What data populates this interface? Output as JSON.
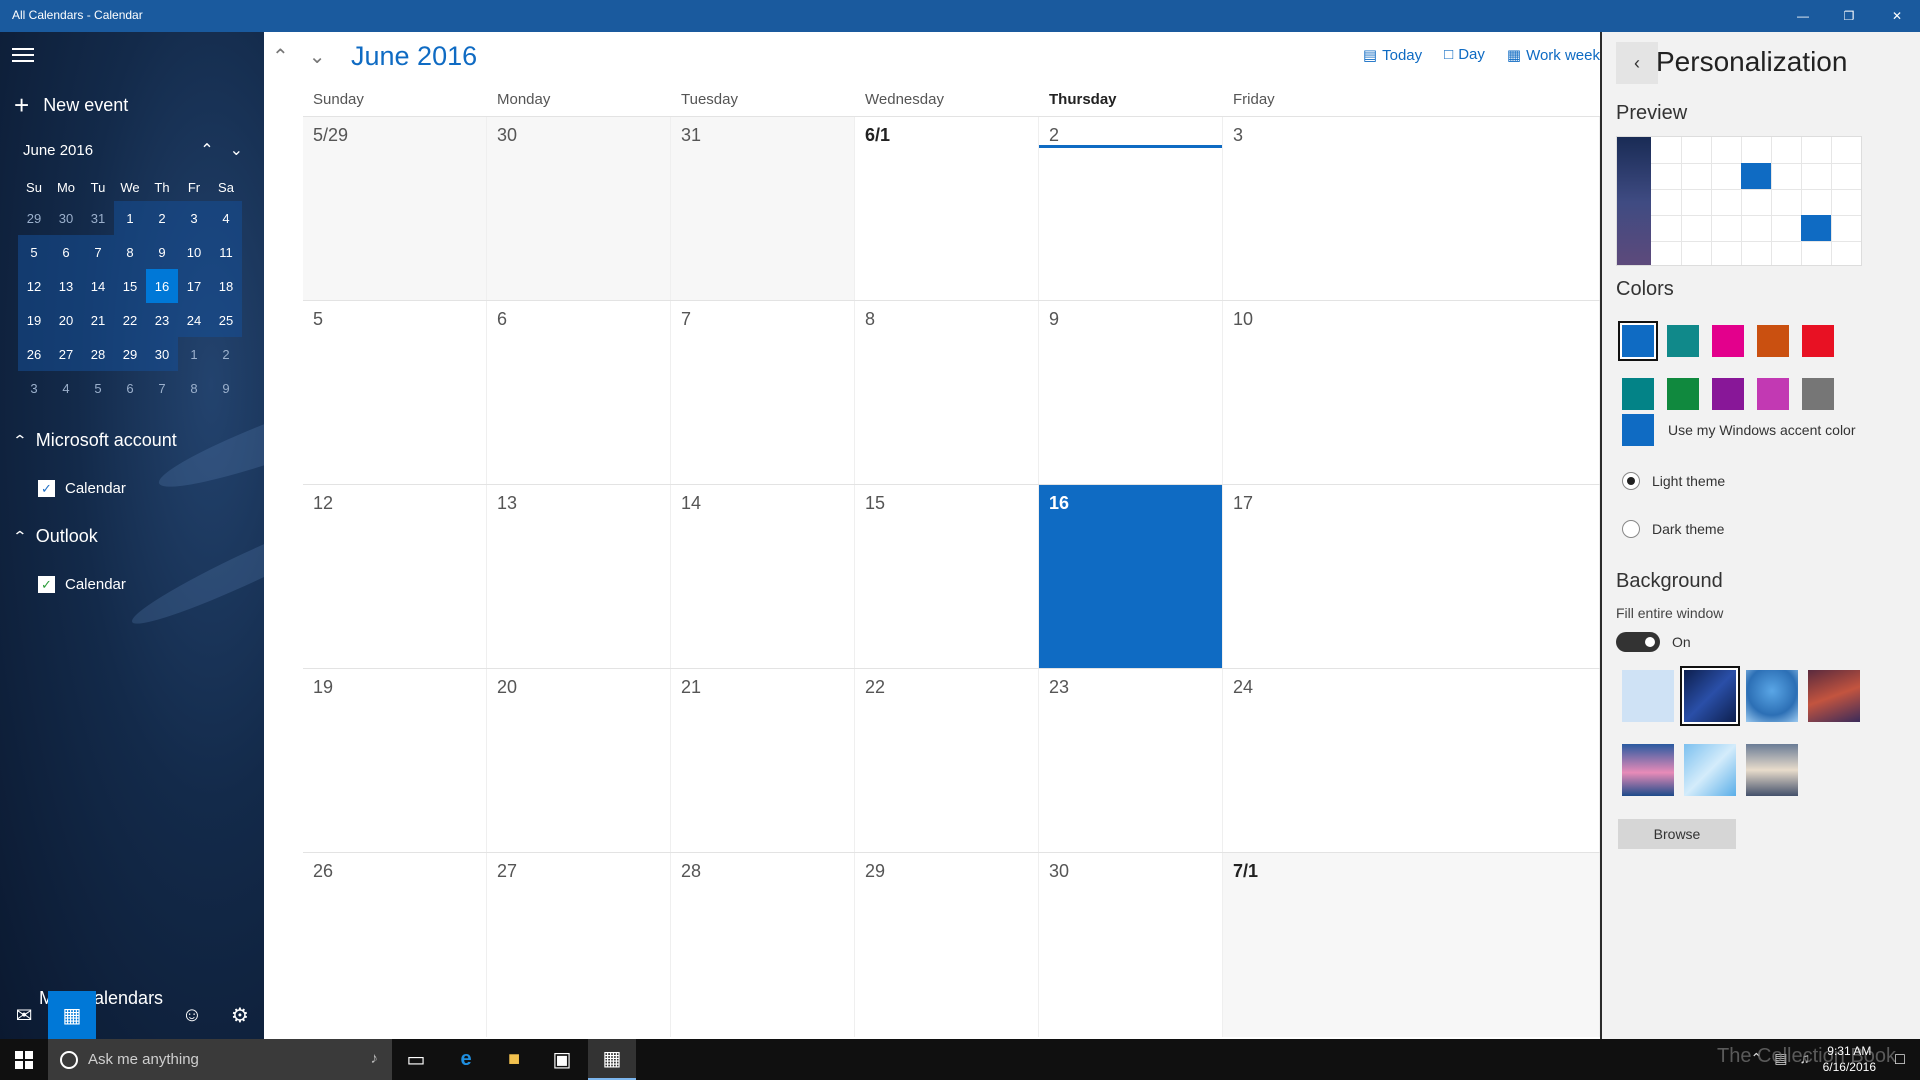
{
  "window": {
    "title": "All Calendars - Calendar"
  },
  "sidebar": {
    "new_event": "New event",
    "mini_calendar": {
      "month": "June 2016",
      "weekdays": [
        "Su",
        "Mo",
        "Tu",
        "We",
        "Th",
        "Fr",
        "Sa"
      ],
      "weeks": [
        [
          "29",
          "30",
          "31",
          "1",
          "2",
          "3",
          "4"
        ],
        [
          "5",
          "6",
          "7",
          "8",
          "9",
          "10",
          "11"
        ],
        [
          "12",
          "13",
          "14",
          "15",
          "16",
          "17",
          "18"
        ],
        [
          "19",
          "20",
          "21",
          "22",
          "23",
          "24",
          "25"
        ],
        [
          "26",
          "27",
          "28",
          "29",
          "30",
          "1",
          "2"
        ],
        [
          "3",
          "4",
          "5",
          "6",
          "7",
          "8",
          "9"
        ]
      ],
      "today": "16"
    },
    "groups": [
      {
        "name": "Microsoft account",
        "calendar": "Calendar",
        "color": "#1f6fc5"
      },
      {
        "name": "Outlook",
        "calendar": "Calendar",
        "color": "#2c9c3a"
      }
    ],
    "more_calendars": "More calendars"
  },
  "main": {
    "month_title": "June 2016",
    "views": {
      "today": "Today",
      "day": "Day",
      "work_week": "Work week"
    },
    "weekdays": [
      "Sunday",
      "Monday",
      "Tuesday",
      "Wednesday",
      "Thursday",
      "Friday"
    ],
    "active_weekday": "Thursday",
    "weeks": [
      [
        "5/29",
        "30",
        "31",
        "6/1",
        "2",
        "3"
      ],
      [
        "5",
        "6",
        "7",
        "8",
        "9",
        "10"
      ],
      [
        "12",
        "13",
        "14",
        "15",
        "16",
        "17"
      ],
      [
        "19",
        "20",
        "21",
        "22",
        "23",
        "24"
      ],
      [
        "26",
        "27",
        "28",
        "29",
        "30",
        "7/1"
      ]
    ],
    "today": "16"
  },
  "panel": {
    "title": "Personalization",
    "preview_title": "Preview",
    "colors_title": "Colors",
    "colors": [
      "#0f6bc3",
      "#10898a",
      "#e3008c",
      "#ca5010",
      "#e81123",
      "#038387",
      "#10893e",
      "#881798",
      "#c239b3",
      "#767676"
    ],
    "selected_color": "#0f6bc3",
    "accent_label": "Use my Windows accent color",
    "light_theme": "Light theme",
    "dark_theme": "Dark theme",
    "theme_selected": "Light theme",
    "background_title": "Background",
    "fill_label": "Fill entire window",
    "toggle_state": "On",
    "browse": "Browse"
  },
  "taskbar": {
    "search_placeholder": "Ask me anything",
    "time": "9:31 AM",
    "date": "6/16/2016",
    "watermark": "The Collection Book"
  }
}
